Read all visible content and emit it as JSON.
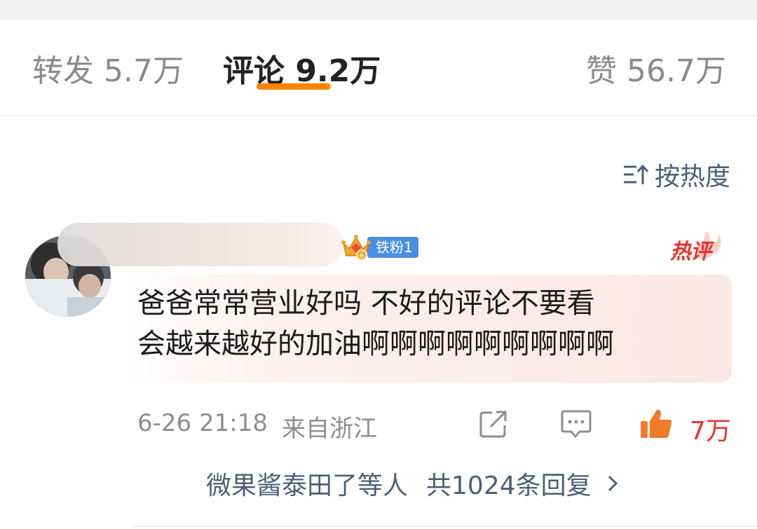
{
  "tabs": {
    "repost": "转发 5.7万",
    "comments": "评论 9.2万",
    "likes": "赞 56.7万",
    "active": "comments",
    "accent_color": "#ff8200"
  },
  "sort": {
    "label": "按热度",
    "icon": "sort-icon"
  },
  "comment": {
    "fan_badge": "铁粉1",
    "crown_level": "6",
    "hot_label": "热评",
    "text": "爸爸常常营业好吗 不好的评论不要看\n会越来越好的加油啊啊啊啊啊啊啊啊啊",
    "date": "6-26 21:18",
    "location": "来自浙江",
    "like_count": "7万",
    "liked": true,
    "like_color": "#e8332a",
    "reply_users": "微果酱泰田了等人",
    "reply_count": "共1024条回复"
  }
}
